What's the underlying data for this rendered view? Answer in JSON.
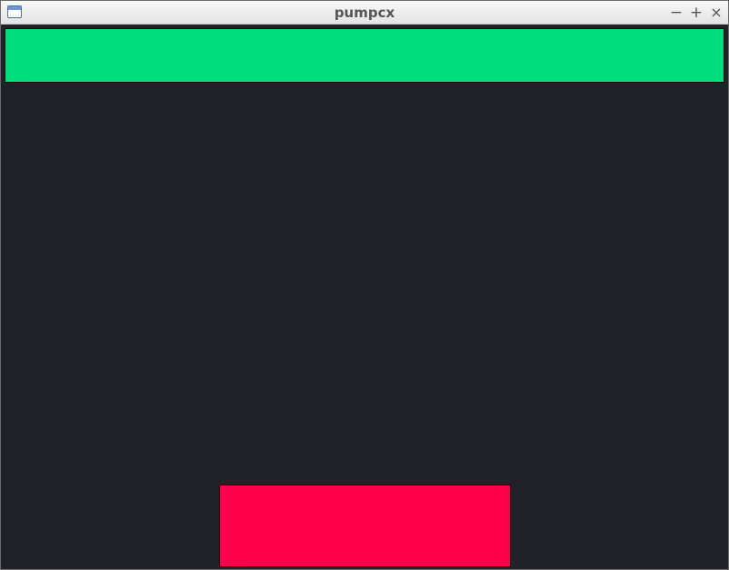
{
  "window": {
    "title": "pumpcx",
    "background_color": "#202227",
    "controls": {
      "minimize": "−",
      "maximize": "+",
      "close": "×"
    }
  },
  "canvas": {
    "top_bar_color": "#00dd7d",
    "bottom_box_color": "#ff004d"
  },
  "icons": {
    "app": "window-icon",
    "minimize": "minimize-icon",
    "maximize": "maximize-icon",
    "close": "close-icon"
  }
}
